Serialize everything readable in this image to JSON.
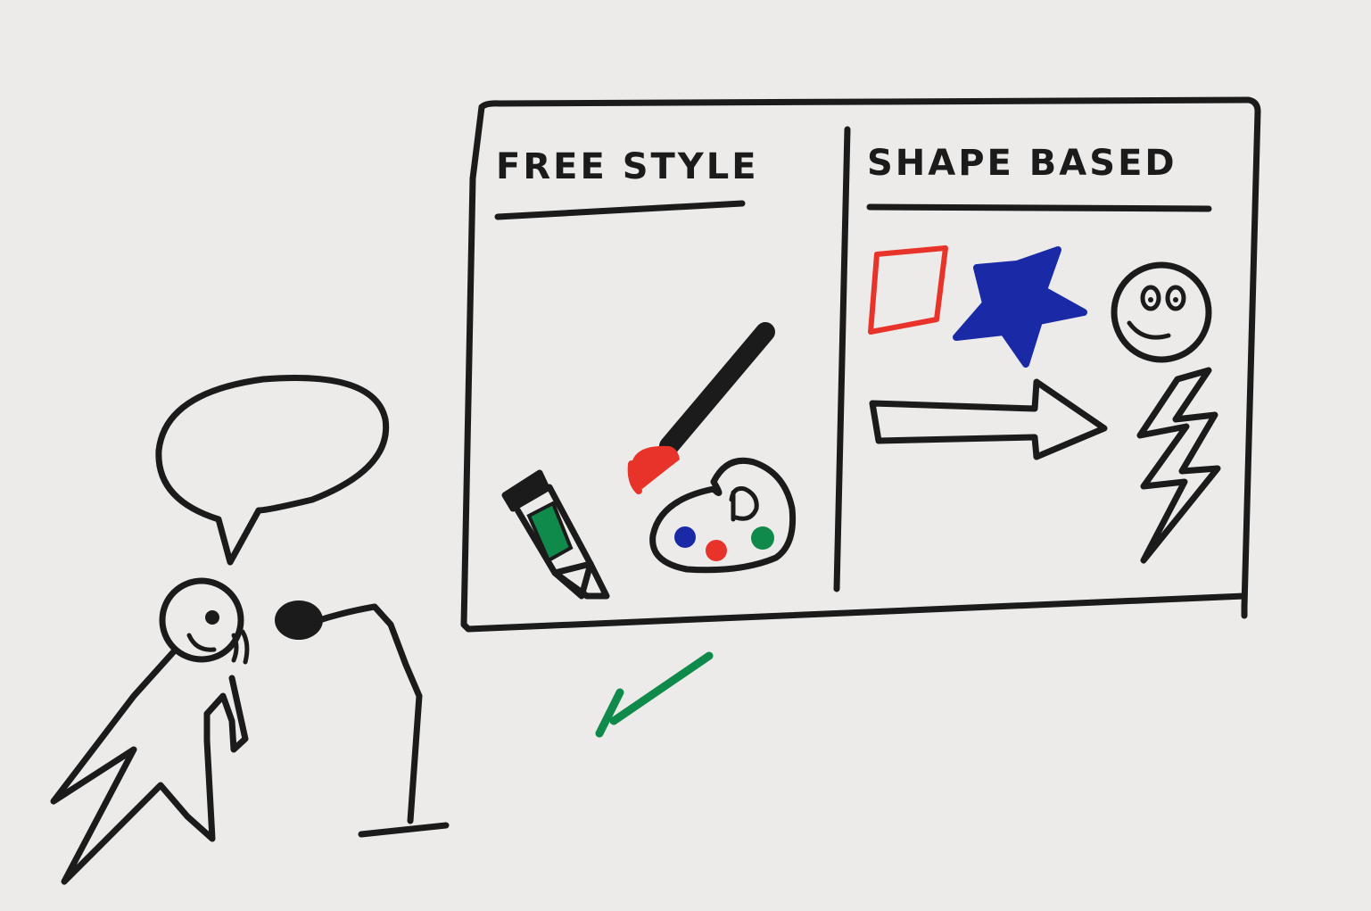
{
  "panels": {
    "left": {
      "heading": "FREE STYLE"
    },
    "right": {
      "heading": "SHAPE BASED"
    }
  },
  "icons": [
    "speech-bubble-icon",
    "presenter-figure-icon",
    "microphone-icon",
    "marker-pen-icon",
    "paint-brush-icon",
    "paint-palette-icon",
    "square-shape-icon",
    "star-shape-icon",
    "smiley-face-icon",
    "arrow-shape-icon",
    "lightning-bolt-icon",
    "checkmark-icon"
  ],
  "colors": {
    "ink": "#1b1b1b",
    "paper": "#ecebe9",
    "red": "#e8332b",
    "blue": "#1a2aa6",
    "green": "#0f8a4a"
  }
}
